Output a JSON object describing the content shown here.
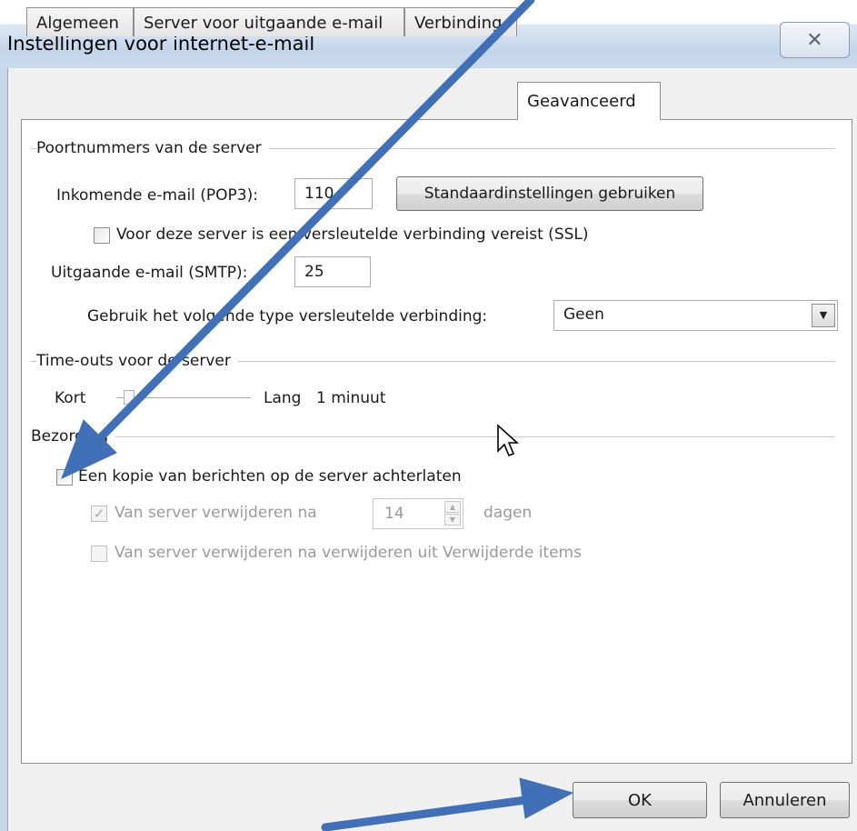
{
  "window": {
    "title": "Instellingen voor internet-e-mail",
    "close_glyph": "✕"
  },
  "tabs": [
    {
      "label": "Algemeen"
    },
    {
      "label": "Server voor uitgaande e-mail"
    },
    {
      "label": "Verbinding"
    },
    {
      "label": "Geavanceerd"
    }
  ],
  "active_tab": "Geavanceerd",
  "ports": {
    "group_label": "Poortnummers van de server",
    "incoming_label": "Inkomende e-mail (POP3):",
    "incoming_value": "110",
    "defaults_button": "Standaardinstellingen gebruiken",
    "ssl_label": "Voor deze server is een versleutelde verbinding vereist (SSL)",
    "ssl_checked": false,
    "outgoing_label": "Uitgaande e-mail (SMTP):",
    "outgoing_value": "25",
    "encryption_label": "Gebruik het volgende type versleutelde verbinding:",
    "encryption_value": "Geen"
  },
  "timeouts": {
    "group_label": "Time-outs voor de server",
    "short_label": "Kort",
    "long_label": "Lang",
    "value_text": "1 minuut",
    "slider_level": 0.1
  },
  "delivery": {
    "group_label": "Bezorging",
    "leave_copy_label": "Een kopie van berichten op de server achterlaten",
    "leave_copy_checked": false,
    "remove_after_label": "Van server verwijderen na",
    "remove_after_checked": true,
    "remove_after_days": "14",
    "days_label": "dagen",
    "remove_deleted_label": "Van server verwijderen na verwijderen uit Verwijderde items",
    "remove_deleted_checked": false
  },
  "footer": {
    "ok_label": "OK",
    "cancel_label": "Annuleren"
  },
  "colors": {
    "annotation_arrow": "#3f70b8",
    "window_chrome": "#c9d9ec"
  }
}
